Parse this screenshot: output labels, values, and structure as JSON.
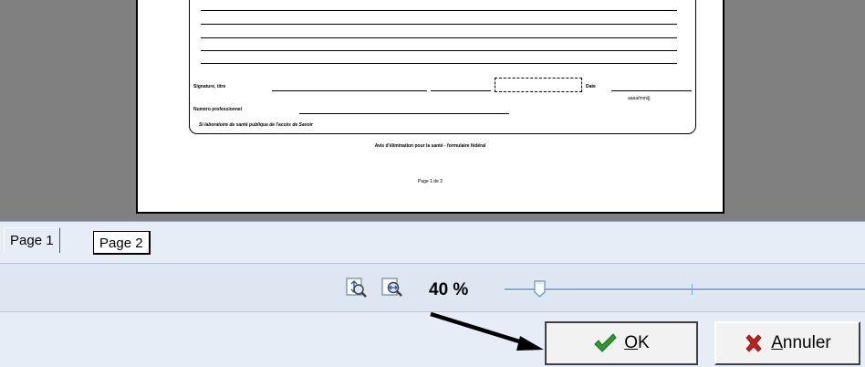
{
  "document": {
    "signature_label": "Signature, titre",
    "date_label": "Date",
    "date_format": "aaaa/mm/jj",
    "professional_number_label": "Numéro professionnel",
    "footnote": "Si laboratoire de santé publique de l'accès de Savoir",
    "center_caption": "Avis d'élimination pour la santé - formulaire fédéral",
    "page_footer": "Page 1 de 2"
  },
  "tabs": [
    {
      "label": "Page 1",
      "active": true
    },
    {
      "label": "Page 2",
      "active": false
    }
  ],
  "zoom": {
    "label": "40 %",
    "value_percent": 40,
    "zoom_fit_height_icon": "zoom-fit-page-icon",
    "zoom_fit_width_icon": "zoom-fit-width-icon"
  },
  "buttons": {
    "ok": {
      "first": "O",
      "rest": "K",
      "icon": "checkmark-icon"
    },
    "cancel": {
      "first": "A",
      "rest": "nnuler",
      "icon": "x-mark-icon"
    }
  },
  "colors": {
    "ok_check": "#2e9a2e",
    "cancel_x": "#c0201a",
    "slider": "#7ea6d6"
  }
}
